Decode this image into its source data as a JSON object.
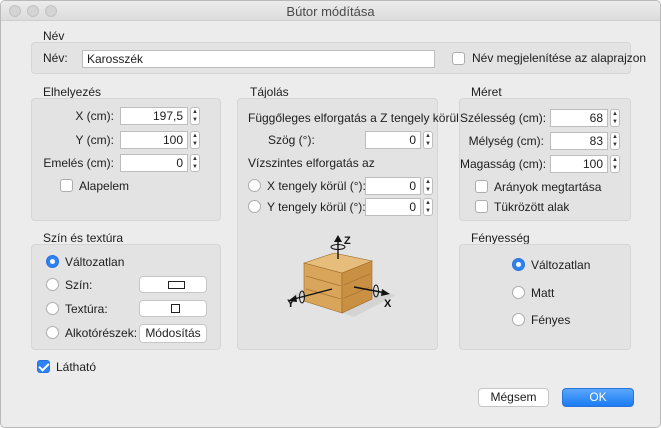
{
  "window": {
    "title": "Bútor módítása"
  },
  "name_section": {
    "title": "Név",
    "name_label": "Név:",
    "name_value": "Karosszék",
    "show_on_plan_label": "Név megjelenítése az alaprajzon",
    "show_on_plan_checked": false
  },
  "placement": {
    "title": "Elhelyezés",
    "x_label": "X (cm):",
    "x_value": "197,5",
    "y_label": "Y (cm):",
    "y_value": "100",
    "elevation_label": "Emelés (cm):",
    "elevation_value": "0",
    "base_item_label": "Alapelem",
    "base_item_checked": false
  },
  "orientation": {
    "title": "Tájolás",
    "vertical_rotation_title": "Függőleges elforgatás a Z tengely körül",
    "angle_label": "Szög (°):",
    "angle_value": "0",
    "horizontal_rotation_title": "Vízszintes elforgatás az",
    "x_axis_label": "X tengely körül (°):",
    "x_axis_value": "0",
    "y_axis_label": "Y tengely körül (°):",
    "y_axis_value": "0",
    "axis_labels": {
      "z": "Z",
      "x": "X",
      "y": "Y"
    }
  },
  "size": {
    "title": "Méret",
    "width_label": "Szélesség (cm):",
    "width_value": "68",
    "depth_label": "Mélység (cm):",
    "depth_value": "83",
    "height_label": "Magasság (cm):",
    "height_value": "100",
    "keep_proportions_label": "Arányok megtartása",
    "keep_proportions_checked": false,
    "mirrored_label": "Tükrözött alak",
    "mirrored_checked": false
  },
  "color_texture": {
    "title": "Szín és textúra",
    "unchanged_label": "Változatlan",
    "color_label": "Szín:",
    "texture_label": "Textúra:",
    "materials_label": "Alkotórészek:",
    "modify_button": "Módosítás",
    "selected": "unchanged"
  },
  "shininess": {
    "title": "Fényesség",
    "unchanged_label": "Változatlan",
    "matte_label": "Matt",
    "shiny_label": "Fényes",
    "selected": "unchanged"
  },
  "visible": {
    "label": "Látható",
    "checked": true
  },
  "buttons": {
    "cancel": "Mégsem",
    "ok": "OK"
  },
  "colors": {
    "accent": "#2d82f7",
    "panel": "#e3e3e3",
    "background": "#ececec"
  }
}
